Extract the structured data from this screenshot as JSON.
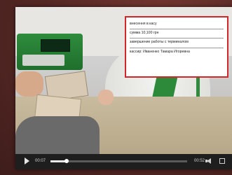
{
  "overlay": {
    "lines": [
      "внесення в касу",
      "сумма 10,100 грн",
      "завершение работы с терминалом",
      "кассир: Иваненко Тамара Игоревна"
    ]
  },
  "player": {
    "current_time": "00:07",
    "duration": "00:52",
    "progress": 0.12
  },
  "icons": {
    "play": "play-icon",
    "volume": "volume-icon",
    "fullscreen": "fullscreen-icon"
  },
  "colors": {
    "overlay_border": "#d3262b",
    "background": "#5a2a26"
  }
}
